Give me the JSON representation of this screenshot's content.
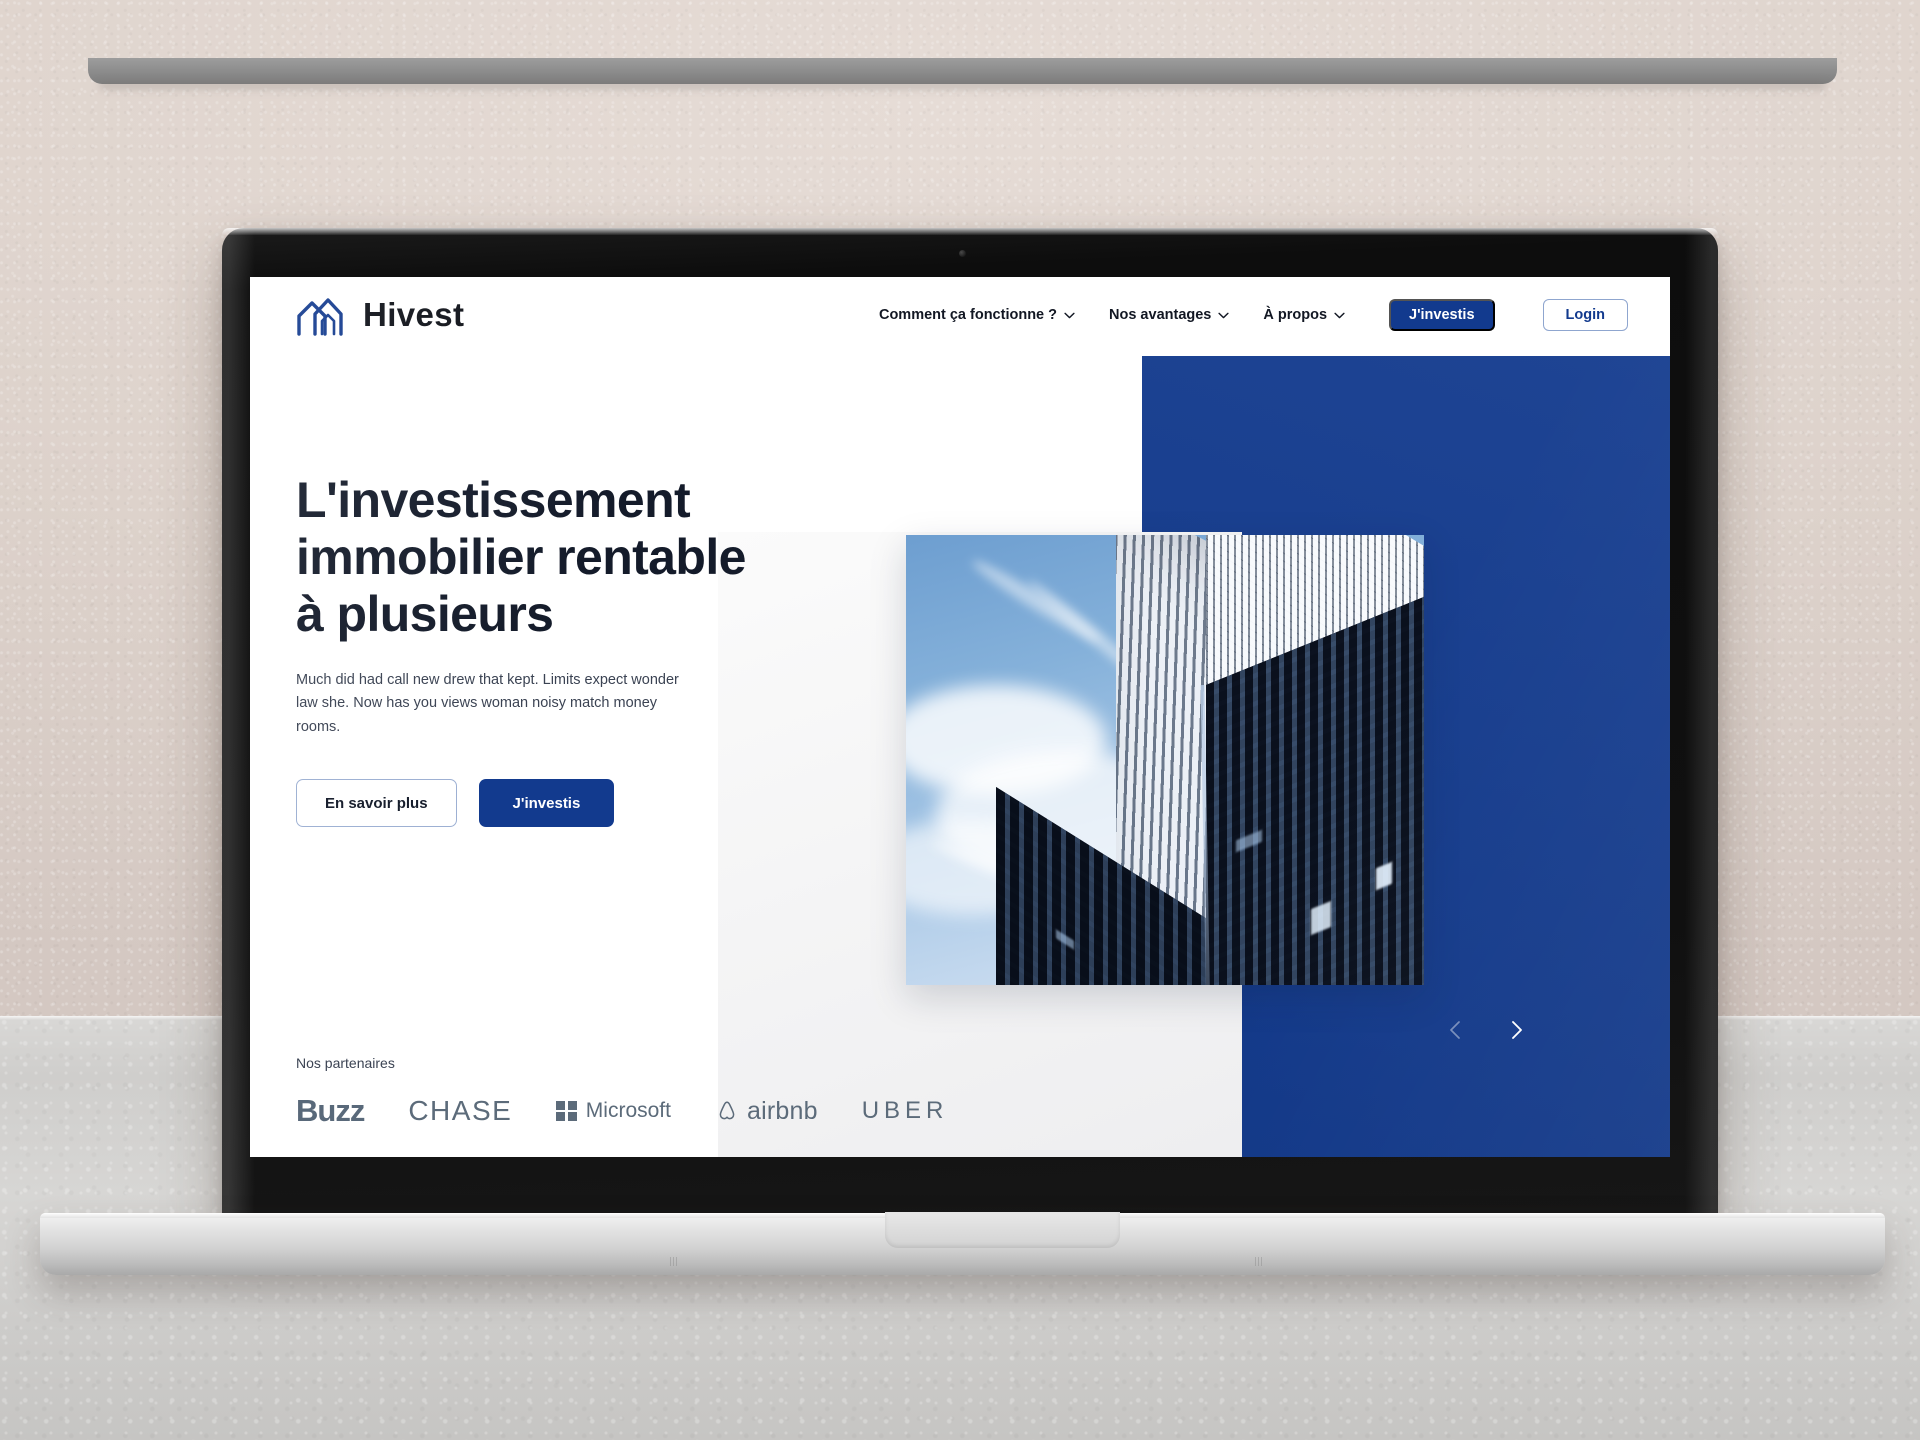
{
  "brand": {
    "name": "Hivest",
    "logo_icon": "double-house-icon",
    "logo_color": "#123a8e"
  },
  "nav": {
    "items": [
      {
        "label": "Comment ça fonctionne ?",
        "has_dropdown": true,
        "icon": "chevron-down-icon"
      },
      {
        "label": "Nos avantages",
        "has_dropdown": true,
        "icon": "chevron-down-icon"
      },
      {
        "label": "À propos",
        "has_dropdown": true,
        "icon": "chevron-down-icon"
      }
    ],
    "cta_primary": "J'investis",
    "cta_login": "Login"
  },
  "hero": {
    "title": "L'investissement immobilier rentable à plusieurs",
    "title_lines": [
      "L'investissement",
      "immobilier rentable",
      "à plusieurs"
    ],
    "subtitle": "Much did had call new drew that kept. Limits expect wonder law she. Now has you views woman noisy match money rooms.",
    "button_secondary": "En savoir plus",
    "button_primary": "J'investis",
    "image_alt": "skyscraper-photo"
  },
  "partners": {
    "label": "Nos partenaires",
    "logos": [
      {
        "name": "Buzz",
        "icon": "buzz-logo"
      },
      {
        "name": "CHASE",
        "icon": "chase-logo"
      },
      {
        "name": "Microsoft",
        "icon": "microsoft-logo"
      },
      {
        "name": "airbnb",
        "icon": "airbnb-logo"
      },
      {
        "name": "UBER",
        "icon": "uber-logo"
      }
    ]
  },
  "carousel": {
    "prev_icon": "chevron-left-icon",
    "next_icon": "chevron-right-icon"
  },
  "colors": {
    "brand_blue": "#123a8e",
    "headline": "#141b2a",
    "body_text": "#3b4353",
    "partner_gray": "#5c6b7a",
    "page_bg": "#ffffff"
  }
}
